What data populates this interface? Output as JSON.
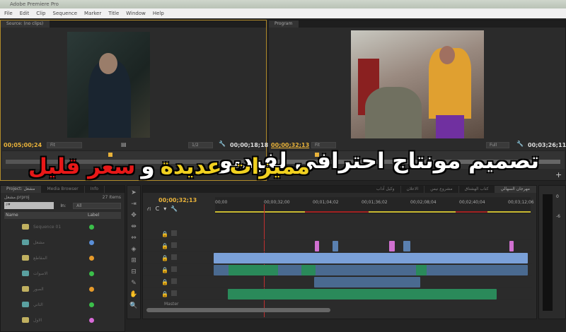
{
  "window": {
    "title": "Adobe Premiere Pro"
  },
  "menu": [
    "File",
    "Edit",
    "Clip",
    "Sequence",
    "Marker",
    "Title",
    "Window",
    "Help"
  ],
  "source_monitor": {
    "tab": "Source: (no clips)",
    "timecode_left": "00;05;00;24",
    "zoom": "Fit",
    "resolution": "1/2",
    "timecode_right": "00;00;18;18"
  },
  "program_monitor": {
    "tab": "Program",
    "timecode_left": "00;00;32;13",
    "zoom": "Fit",
    "resolution": "Full",
    "timecode_right": "00;03;26;11",
    "add": "+"
  },
  "overlay": {
    "line1": "تصميم مونتاج احترافي لفيديو",
    "line2_yellow": "مميزات عديدة",
    "line2_white": "و",
    "line2_red": "سعر قليل"
  },
  "project": {
    "tab": "Project: مشعل",
    "tab2": "Media Browser",
    "tab3": "Info",
    "file": "مشعل.prproj",
    "count": "27 Items",
    "in_label": "In:",
    "in_value": "All",
    "col_name": "Name",
    "col_label": "Label",
    "items": [
      {
        "name": "Sequence 01",
        "color": "#3bbf4a"
      },
      {
        "name": "مشعل",
        "color": "#5a8fd8"
      },
      {
        "name": "المقاطع",
        "color": "#e69a2a"
      },
      {
        "name": "الاصوات",
        "color": "#3bbf4a"
      },
      {
        "name": "الصور",
        "color": "#e69a2a"
      },
      {
        "name": "الثاني",
        "color": "#3bbf4a"
      },
      {
        "name": "الاول",
        "color": "#d86ad8"
      }
    ]
  },
  "timeline": {
    "tabs": [
      "وكيل آداب",
      "الاعلان",
      "مشروع نيس",
      "كتاب الهشتاق",
      "مهرجان السهالي"
    ],
    "timecode": "00;00;32;13",
    "ruler": [
      "00;00",
      "00;00;32;00",
      "00;01;04;02",
      "00;01;36;02",
      "00;02;08;04",
      "00;02;40;04",
      "00;03;12;06"
    ],
    "master": "Master"
  },
  "meter": {
    "labels": [
      "0",
      "-6"
    ]
  }
}
